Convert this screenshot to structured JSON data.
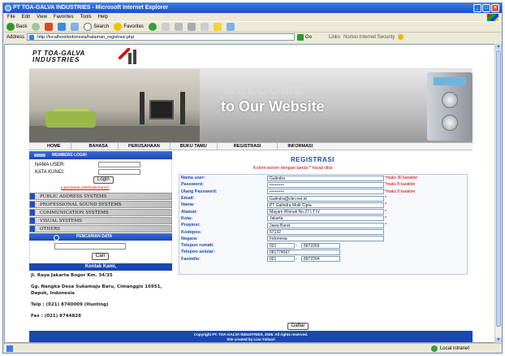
{
  "window": {
    "title": "PT TOA-GALVA INDUSTRIES - Microsoft Internet Explorer"
  },
  "menu": [
    "File",
    "Edit",
    "View",
    "Favorites",
    "Tools",
    "Help"
  ],
  "toolbar": {
    "back": "Back",
    "search": "Search",
    "favorites": "Favorites"
  },
  "address": {
    "label": "Address",
    "url": "http://localhost/indonesia/halaman_registrasi.php",
    "go": "Go",
    "links": "Links",
    "nis": "Norton Internet Security"
  },
  "status": {
    "zone": "Local intranet"
  },
  "site": {
    "logo_line1": "PT TOA-GALVA",
    "logo_line2": "INDUSTRIES",
    "banner_line1": "WELCOME",
    "banner_line2": "to Our Website",
    "nav": [
      "HOME",
      "BAHASA",
      "PERUSAHAAN",
      "BUKU TAMU",
      "REGISTRASI",
      "INFORMASI"
    ]
  },
  "sidebar": {
    "member_header": "MEMBERS LOGIN",
    "username_label": "NAMA USER:",
    "password_label": "KATA KUNCI:",
    "login_button": "Login",
    "forgot_link": "Lupa Nama User/Kata Kunci?",
    "categories": [
      "PUBLIC ADDRESS SYSTEMS",
      "PROFESSIONAL SOUND SYSTEMS",
      "COMMUNICATION SYSTEMS",
      "VISUAL SYSTEMS",
      "OTHERS"
    ],
    "search_header": "PENCARIAN DATA",
    "search_button": "Cari",
    "contact_header": "Kontak Kami,",
    "address1": "Jl. Raya Jakarta Bogor Km. 34/35",
    "address2": "Gg. Nangka Desa Sukamaju Baru, Cimanggis 16951, Depok, Indonesia",
    "phone": "Telp : (021) 8740009 (Hunting)",
    "fax": "Fax : (021) 8744828"
  },
  "registration": {
    "title": "REGISTRASI",
    "note": "Kolom-kolom dengan tanda * harap diisi",
    "fields": [
      {
        "label": "Nama user:",
        "value": "Galindra",
        "hint": "*maks 30 karakter"
      },
      {
        "label": "Password:",
        "value": "••••••••",
        "hint": "*maks 8 karakter"
      },
      {
        "label": "Ulang Password:",
        "value": "••••••••",
        "hint": "*maks 8 karakter"
      },
      {
        "label": "Email:",
        "value": "Galindra@cbn.net.id",
        "hint": "*"
      },
      {
        "label": "Nama:",
        "value": "PT Galindra Multi Cipta",
        "hint": "*"
      },
      {
        "label": "Alamat:",
        "value": "Mayam Wisnuk No 27 LT IV",
        "hint": "*"
      },
      {
        "label": "Kota:",
        "value": "Jakarta",
        "hint": "*"
      },
      {
        "label": "Propinsi:",
        "value": "Jawa Barat",
        "hint": "*"
      },
      {
        "label": "Kodepos:",
        "value": "57132",
        "hint": ""
      },
      {
        "label": "Negara:",
        "value": "Indonesia",
        "hint": ""
      }
    ],
    "phone_home": {
      "label": "Telepon rumah:",
      "code": "021",
      "number": "8972203"
    },
    "phone_cell": {
      "label": "Telepon selular:",
      "value": "081774567"
    },
    "fax": {
      "label": "Faximile:",
      "code": "021",
      "number": "8972204"
    },
    "submit": "Daftar"
  },
  "footer": {
    "line1": "Copyright PT. TOA-GALVA INDUSTRIES, 2006. All rights reserved.",
    "line2": "Site created by Lisa Yulisari"
  }
}
